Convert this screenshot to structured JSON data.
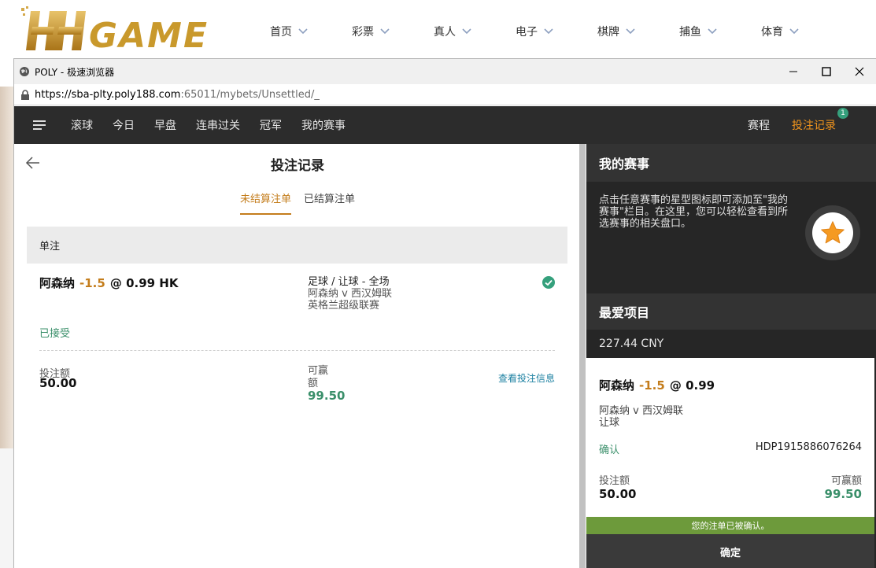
{
  "site": {
    "logo_text": "GAME",
    "nav": [
      "首页",
      "彩票",
      "真人",
      "电子",
      "棋牌",
      "捕鱼",
      "体育"
    ]
  },
  "browser": {
    "title": "POLY - 极速浏览器",
    "url_host": "https://sba-plty.poly188.com",
    "url_path": ":65011/mybets/Unsettled/_"
  },
  "appnav": {
    "items": [
      "滚球",
      "今日",
      "早盘",
      "连串过关",
      "冠军",
      "我的赛事"
    ],
    "schedule": "赛程",
    "bet_record": "投注记录",
    "badge": "1"
  },
  "main": {
    "title": "投注记录",
    "tabs": [
      "未结算注单",
      "已结算注单"
    ],
    "section": "单注",
    "bet": {
      "team": "阿森纳",
      "handicap": "-1.5",
      "at": "@",
      "odds": "0.99 HK",
      "market": "足球 / 让球 - 全场",
      "match": "阿森纳 v 西汉姆联",
      "league": "英格兰超级联赛",
      "status": "已接受",
      "stake_label": "投注额",
      "stake": "50.00",
      "win_label": "可赢额",
      "win": "99.50",
      "view_info": "查看投注信息"
    }
  },
  "right": {
    "mymatch_title": "我的赛事",
    "mymatch_text": "点击任意赛事的星型图标即可添加至\"我的赛事\"栏目。在这里，您可以轻松查看到所选赛事的相关盘口。",
    "fav_title": "最爱项目",
    "balance": "227.44 CNY",
    "slip": {
      "team": "阿森纳",
      "handicap": "-1.5",
      "at": "@",
      "odds": "0.99",
      "match": "阿森纳 v 西汉姆联",
      "market": "让球",
      "confirm": "确认",
      "id": "HDP1915886076264",
      "stake_label": "投注额",
      "stake": "50.00",
      "win_label": "可赢额",
      "win": "99.50"
    },
    "confirm_msg": "您的注单已被确认。",
    "ok": "确定"
  },
  "colors": {
    "accent_orange": "#c47d1c",
    "nav_active": "#f0941d",
    "green": "#3a8f6a",
    "confirm_bar": "#6d9a3b"
  }
}
